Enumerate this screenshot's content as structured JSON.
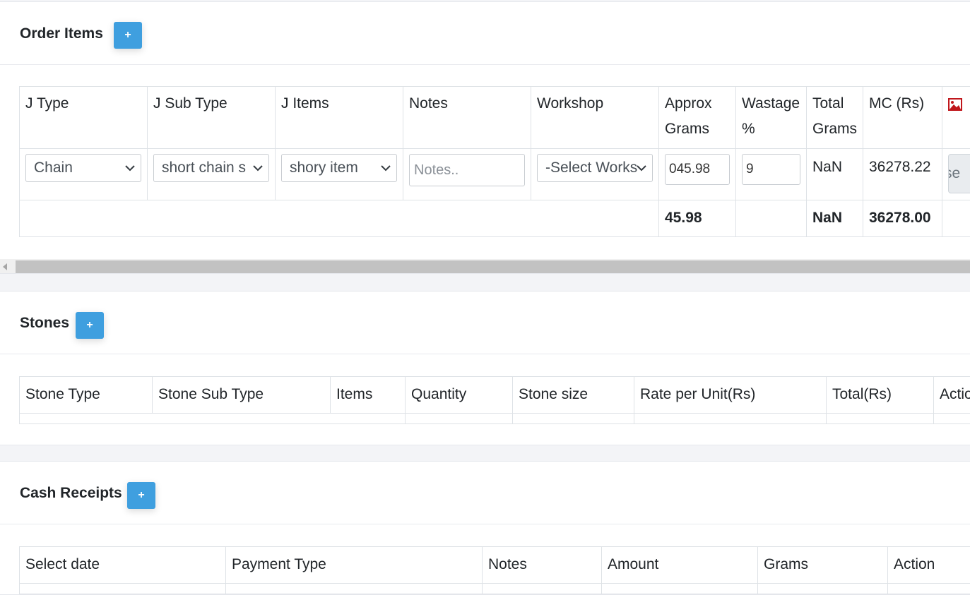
{
  "order_items": {
    "title": "Order Items",
    "add_label": "+",
    "headers": [
      "J Type",
      "J Sub Type",
      "J Items",
      "Notes",
      "Workshop",
      "Approx Grams",
      "Wastage %",
      "Total Grams",
      "MC (Rs)"
    ],
    "row": {
      "j_type": "Chain",
      "j_sub_type": "short chain s",
      "j_items": "shory item",
      "notes_placeholder": "Notes..",
      "workshop": "-Select Works",
      "approx_grams": "045.98",
      "wastage": "9",
      "total_grams": "NaN",
      "mc": "36278.22",
      "action_label": "se"
    },
    "totals": {
      "approx_grams": "45.98",
      "total_grams": "NaN",
      "mc": "36278.00"
    }
  },
  "stones": {
    "title": "Stones",
    "add_label": "+",
    "headers": [
      "Stone Type",
      "Stone Sub Type",
      "Items",
      "Quantity",
      "Stone size",
      "Rate per Unit(Rs)",
      "Total(Rs)",
      "Actio"
    ]
  },
  "cash_receipts": {
    "title": "Cash Receipts",
    "add_label": "+",
    "headers": [
      "Select date",
      "Payment Type",
      "Notes",
      "Amount",
      "Grams",
      "Action"
    ]
  },
  "colors": {
    "accent": "#3f9fdf",
    "image_icon": "#c0171c"
  }
}
